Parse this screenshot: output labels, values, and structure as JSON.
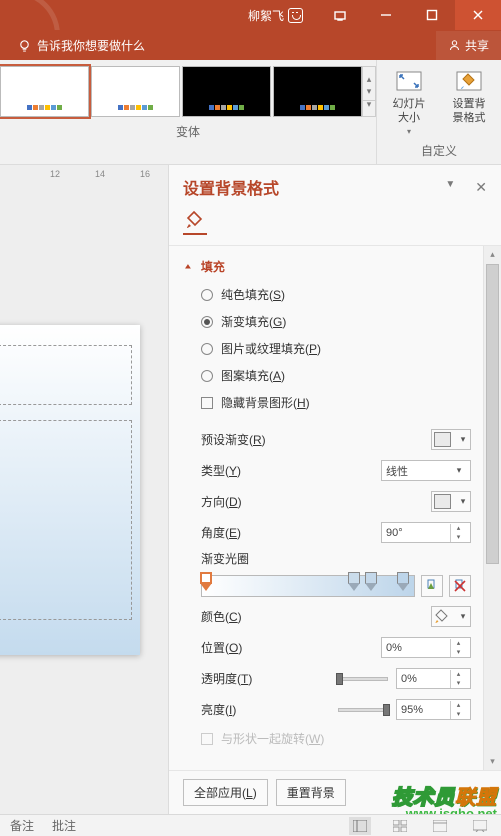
{
  "title": "柳絮飞",
  "tellme": "告诉我你想要做什么",
  "share": "共享",
  "ribbon": {
    "variants_label": "变体",
    "custom_label": "自定义",
    "slide_size": "幻灯片\n大小",
    "bg_format": "设置背\n景格式"
  },
  "ruler": [
    "12",
    "14",
    "16"
  ],
  "pane": {
    "title": "设置背景格式",
    "section_fill": "填充",
    "radios": [
      {
        "label_pre": "纯色填充(",
        "u": "S",
        "label_post": ")"
      },
      {
        "label_pre": "渐变填充(",
        "u": "G",
        "label_post": ")"
      },
      {
        "label_pre": "图片或纹理填充(",
        "u": "P",
        "label_post": ")"
      },
      {
        "label_pre": "图案填充(",
        "u": "A",
        "label_post": ")"
      }
    ],
    "hide_bg_pre": "隐藏背景图形(",
    "hide_bg_u": "H",
    "hide_bg_post": ")",
    "preset_pre": "预设渐变(",
    "preset_u": "R",
    "preset_post": ")",
    "type_pre": "类型(",
    "type_u": "Y",
    "type_post": ")",
    "type_value": "线性",
    "dir_pre": "方向(",
    "dir_u": "D",
    "dir_post": ")",
    "angle_pre": "角度(",
    "angle_u": "E",
    "angle_post": ")",
    "angle_value": "90°",
    "stops_label": "渐变光圈",
    "color_pre": "颜色(",
    "color_u": "C",
    "color_post": ")",
    "pos_pre": "位置(",
    "pos_u": "O",
    "pos_post": ")",
    "pos_value": "0%",
    "trans_pre": "透明度(",
    "trans_u": "T",
    "trans_post": ")",
    "trans_value": "0%",
    "bright_pre": "亮度(",
    "bright_u": "I",
    "bright_post": ")",
    "bright_value": "95%",
    "rotate_pre": "与形状一起旋转(",
    "rotate_u": "W",
    "rotate_post": ")",
    "apply_all_pre": "全部应用(",
    "apply_all_u": "L",
    "apply_all_post": ")",
    "reset": "重置背景"
  },
  "status": {
    "comments": "批注",
    "notes": "备注"
  },
  "watermark": {
    "line1_a": "技术员",
    "line1_b": "联盟",
    "line2": "www.jsgho.net"
  }
}
